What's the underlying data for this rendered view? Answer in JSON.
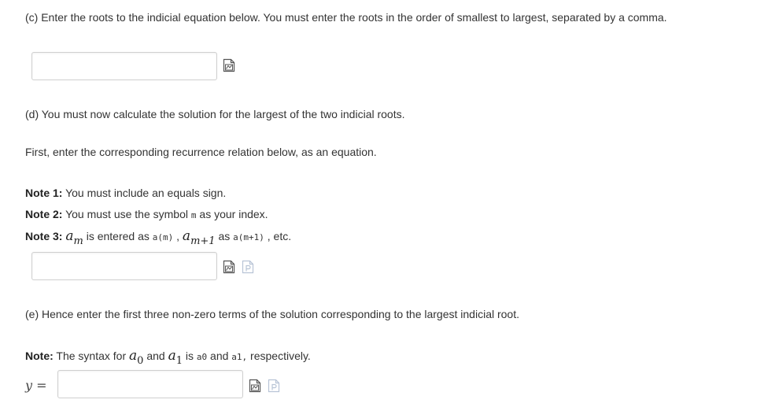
{
  "part_c": {
    "prompt": "(c) Enter the roots to the indicial equation below. You must enter the roots in the order of smallest to largest, separated by a comma.",
    "input_value": "",
    "preview_icon": "equation-preview-icon"
  },
  "part_d": {
    "prompt": "(d) You must now calculate the solution for the largest of the two indicial roots.",
    "instruction": "First, enter the corresponding recurrence relation below, as an equation.",
    "note1_label": "Note 1:",
    "note1_text": " You must include an equals sign.",
    "note2_label": "Note 2:",
    "note2_text_before": " You must use the symbol ",
    "note2_code": "m",
    "note2_text_after": " as your index.",
    "note3_label": "Note 3:",
    "note3_math_a": "a",
    "note3_math_a_sub": "m",
    "note3_text1": " is entered as ",
    "note3_code1": "a(m)",
    "note3_comma": " , ",
    "note3_math_b": "a",
    "note3_math_b_sub": "m+1",
    "note3_text2": " as ",
    "note3_code2": "a(m+1)",
    "note3_text3": " , etc.",
    "input_value": "",
    "preview_icon": "equation-preview-icon",
    "palette_icon": "formula-palette-icon"
  },
  "part_e": {
    "prompt": "(e) Hence enter the first three non-zero terms of the solution corresponding to the largest indicial root.",
    "note_label": "Note:",
    "note_text1": " The syntax for ",
    "math_a0": "a",
    "math_a0_sub": "0",
    "note_text2": " and ",
    "math_a1": "a",
    "math_a1_sub": "1",
    "note_text3": " is ",
    "code_a0": "a0",
    "note_text4": " and ",
    "code_a1": "a1,",
    "note_text5": " respectively.",
    "y_label": "y =",
    "input_value": "",
    "preview_icon": "equation-preview-icon",
    "palette_icon": "formula-palette-icon"
  },
  "colors": {
    "text": "#333333",
    "input_border": "#cfcfcf",
    "icon_dark": "#555555",
    "icon_light": "#b8c4d6"
  }
}
